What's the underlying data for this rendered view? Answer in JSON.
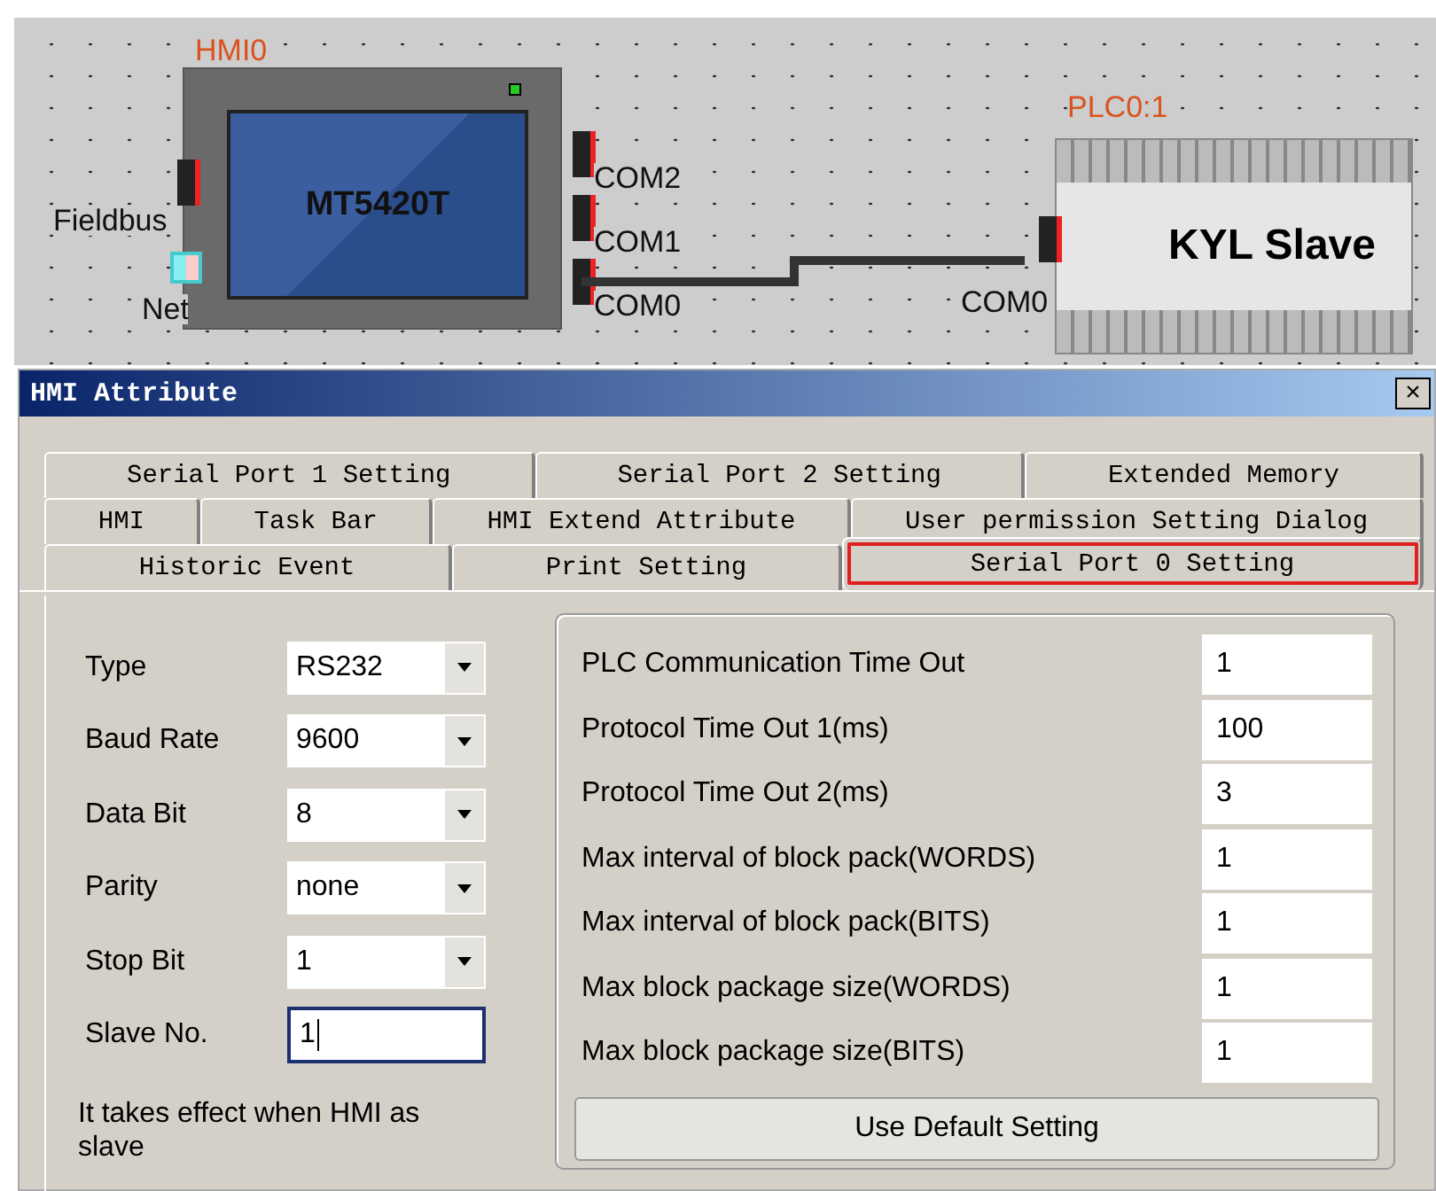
{
  "diagram": {
    "hmi": {
      "name": "HMI0",
      "model": "MT5420T",
      "ports": [
        "COM2",
        "COM1",
        "COM0"
      ],
      "fieldbus_label": "Fieldbus",
      "net_label": "Net"
    },
    "plc": {
      "name": "PLC0:1",
      "label": "KYL Slave",
      "port": "COM0"
    }
  },
  "window": {
    "title": "HMI Attribute",
    "close": "×"
  },
  "tab_rows": [
    [
      {
        "label": "Serial Port 1 Setting",
        "selected": false,
        "annotated": false
      },
      {
        "label": "Serial Port 2 Setting",
        "selected": false,
        "annotated": false
      },
      {
        "label": "Extended Memory",
        "selected": false,
        "annotated": false
      }
    ],
    [
      {
        "label": "HMI",
        "selected": false,
        "annotated": false
      },
      {
        "label": "Task Bar",
        "selected": false,
        "annotated": false
      },
      {
        "label": "HMI Extend Attribute",
        "selected": false,
        "annotated": false
      },
      {
        "label": "User permission Setting Dialog",
        "selected": false,
        "annotated": false
      }
    ],
    [
      {
        "label": "Historic Event",
        "selected": false,
        "annotated": false
      },
      {
        "label": "Print Setting",
        "selected": false,
        "annotated": false
      },
      {
        "label": "Serial Port 0 Setting",
        "selected": true,
        "annotated": true
      }
    ]
  ],
  "port_fields": [
    {
      "label": "Type",
      "kind": "dropdown",
      "value": "RS232"
    },
    {
      "label": "Baud Rate",
      "kind": "dropdown",
      "value": "9600"
    },
    {
      "label": "Data Bit",
      "kind": "dropdown",
      "value": "8"
    },
    {
      "label": "Parity",
      "kind": "dropdown",
      "value": "none"
    },
    {
      "label": "Stop Bit",
      "kind": "dropdown",
      "value": "1"
    },
    {
      "label": "Slave No.",
      "kind": "text",
      "value": "1",
      "focused": true
    }
  ],
  "slave_note": "It takes effect when HMI as slave",
  "timeouts": [
    {
      "label": "PLC Communication Time Out",
      "value": "1"
    },
    {
      "label": "Protocol Time Out 1(ms)",
      "value": "100"
    },
    {
      "label": "Protocol Time Out 2(ms)",
      "value": "3"
    },
    {
      "label": "Max interval of block pack(WORDS)",
      "value": "1"
    },
    {
      "label": "Max interval of block pack(BITS)",
      "value": "1"
    },
    {
      "label": "Max block package size(WORDS)",
      "value": "1"
    },
    {
      "label": "Max block package size(BITS)",
      "value": "1"
    }
  ],
  "default_button": "Use Default Setting"
}
